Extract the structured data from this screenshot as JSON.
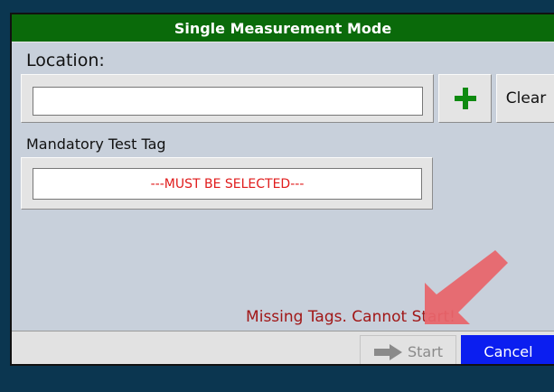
{
  "dialog": {
    "title": "Single Measurement Mode"
  },
  "location": {
    "label": "Location:",
    "value": "",
    "add_icon": "plus-icon",
    "clear_label": "Clear"
  },
  "tag": {
    "label": "Mandatory Test Tag",
    "value": "---MUST BE SELECTED---",
    "value_color": "#e01b1b"
  },
  "status": {
    "message": "Missing Tags. Cannot Start!",
    "color": "#a11717"
  },
  "footer": {
    "start_label": "Start",
    "start_icon": "arrow-right-icon",
    "start_enabled": false,
    "cancel_label": "Cancel"
  },
  "colors": {
    "title_bar": "#0a6a0a",
    "cancel": "#0b1ef0",
    "annotation_arrow": "#e8656b"
  }
}
